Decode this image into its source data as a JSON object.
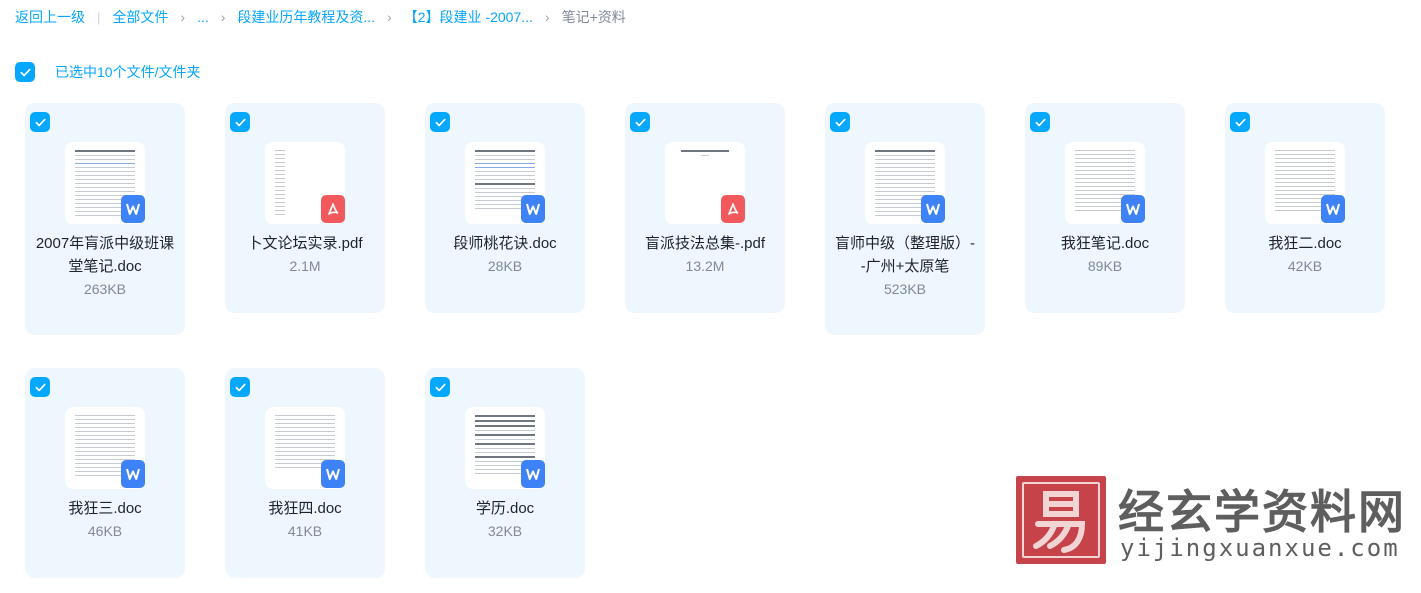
{
  "breadcrumb": {
    "back": "返回上一级",
    "all_files": "全部文件",
    "ellipsis": "...",
    "level1": "段建业历年教程及资...",
    "level2": "【2】段建业 -2007...",
    "current": "笔记+资料"
  },
  "selection": {
    "label": "已选中10个文件/文件夹"
  },
  "files": [
    {
      "name": "2007年肓派中级班课堂笔记.doc",
      "size": "263KB",
      "type": "doc"
    },
    {
      "name": "卜文论坛实录.pdf",
      "size": "2.1M",
      "type": "pdf"
    },
    {
      "name": "段师桃花诀.doc",
      "size": "28KB",
      "type": "doc"
    },
    {
      "name": "盲派技法总集-.pdf",
      "size": "13.2M",
      "type": "pdf"
    },
    {
      "name": "盲师中级（整理版）--广州+太原笔",
      "size": "523KB",
      "type": "doc"
    },
    {
      "name": "我狂笔记.doc",
      "size": "89KB",
      "type": "doc"
    },
    {
      "name": "我狂二.doc",
      "size": "42KB",
      "type": "doc"
    },
    {
      "name": "我狂三.doc",
      "size": "46KB",
      "type": "doc"
    },
    {
      "name": "我狂四.doc",
      "size": "41KB",
      "type": "doc"
    },
    {
      "name": "学历.doc",
      "size": "32KB",
      "type": "doc"
    }
  ],
  "watermark": {
    "title": "经玄学资料网",
    "url": "yijingxuanxue.com",
    "seal_char": "易"
  },
  "icons": {
    "checkbox": "checkmark-icon",
    "doc_badge": "word-doc-icon",
    "pdf_badge": "pdf-icon"
  },
  "colors": {
    "accent": "#06a7ff",
    "card_bg": "#eef7fe",
    "doc_badge": "#3d82f6",
    "pdf_badge": "#f2595c",
    "seal": "#c64449"
  }
}
